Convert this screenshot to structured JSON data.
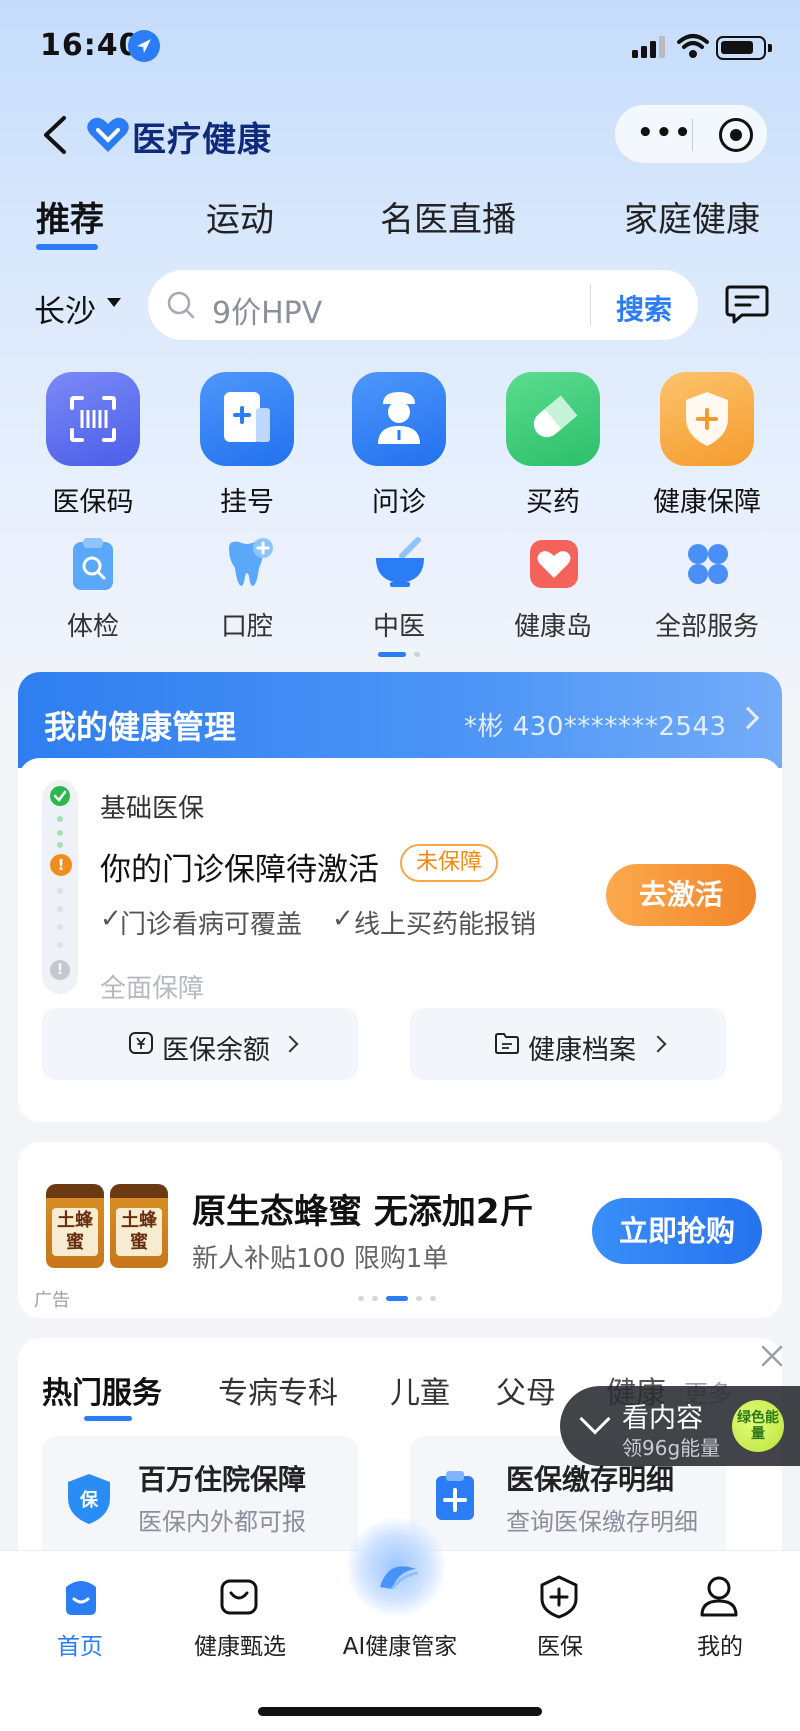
{
  "status_bar": {
    "time": "16:40"
  },
  "header": {
    "brand": "医疗健康"
  },
  "tabs": [
    {
      "label": "推荐",
      "active": true
    },
    {
      "label": "运动"
    },
    {
      "label": "名医直播"
    },
    {
      "label": "家庭健康"
    }
  ],
  "search": {
    "city": "长沙",
    "placeholder": "9价HPV",
    "button": "搜索"
  },
  "services_primary": [
    {
      "label": "医保码",
      "icon": "scan-code-icon",
      "color": "#5b6cf0"
    },
    {
      "label": "挂号",
      "icon": "register-icon",
      "color": "#2f7ef5"
    },
    {
      "label": "问诊",
      "icon": "doctor-icon",
      "color": "#2f7ef5"
    },
    {
      "label": "买药",
      "icon": "pill-icon",
      "color": "#2fc46b"
    },
    {
      "label": "健康保障",
      "icon": "shield-icon",
      "color": "#f7a43a"
    }
  ],
  "services_secondary": [
    {
      "label": "体检",
      "icon": "checkup-icon"
    },
    {
      "label": "口腔",
      "icon": "tooth-icon"
    },
    {
      "label": "中医",
      "icon": "herbal-bowl-icon"
    },
    {
      "label": "健康岛",
      "icon": "heart-icon"
    },
    {
      "label": "全部服务",
      "icon": "grid-icon"
    }
  ],
  "health": {
    "title": "我的健康管理",
    "user_id": "*彬 430*******2543",
    "level_basic": "基础医保",
    "level_outpatient": "你的门诊保障待激活",
    "badge": "未保障",
    "perk1": "门诊看病可覆盖",
    "perk2": "线上买药能报销",
    "level_full": "全面保障",
    "activate": "去激活",
    "balance": "医保余额",
    "records": "健康档案"
  },
  "ad": {
    "title": "原生态蜂蜜 无添加2斤",
    "subtitle": "新人补贴100 限购1单",
    "button": "立即抢购",
    "tag": "广告",
    "jar_label": "土蜂蜜"
  },
  "hot": {
    "tabs": [
      "热门服务",
      "专病专科",
      "儿童",
      "父母",
      "健康"
    ],
    "more": "更多",
    "items": [
      {
        "title": "百万住院保障",
        "sub": "医保内外都可报",
        "icon": "insurance-shield-icon"
      },
      {
        "title": "医保缴存明细",
        "sub": "查询医保缴存明细",
        "icon": "clipboard-plus-icon"
      }
    ]
  },
  "float": {
    "title": "看内容",
    "subtitle": "领96g能量",
    "badge": "绿色能量"
  },
  "bottom_nav": [
    {
      "label": "首页",
      "active": true
    },
    {
      "label": "健康甄选"
    },
    {
      "label": "AI健康管家"
    },
    {
      "label": "医保"
    },
    {
      "label": "我的"
    }
  ]
}
